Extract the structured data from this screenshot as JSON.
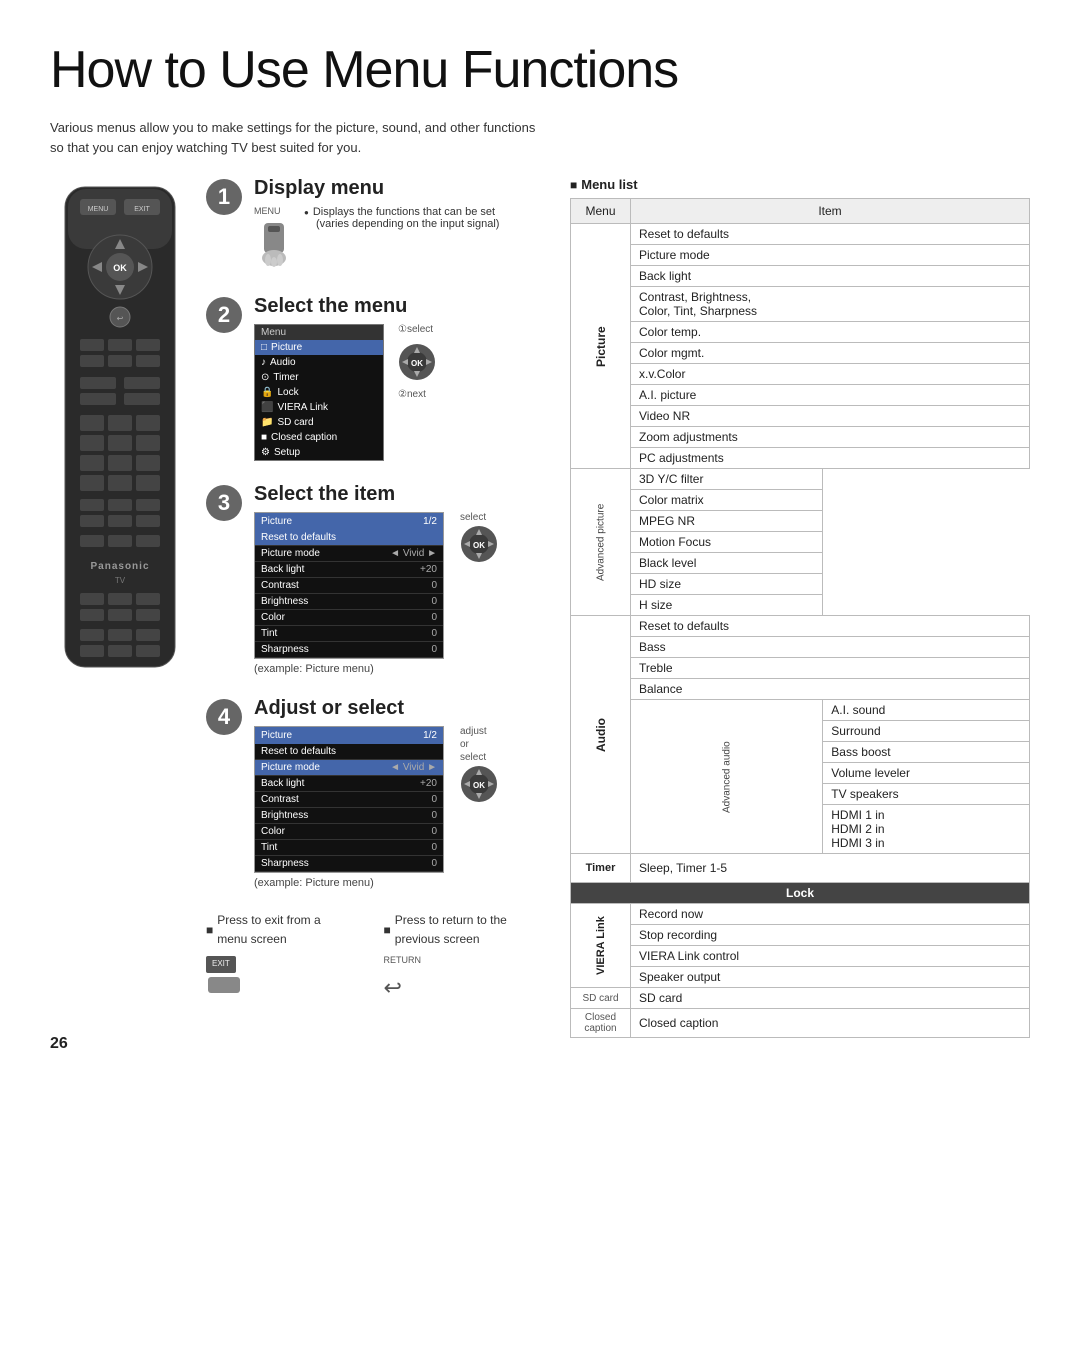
{
  "page": {
    "title": "How to Use Menu Functions",
    "intro": "Various menus allow you to make settings for the picture, sound, and other functions so that you can enjoy watching TV best suited for you.",
    "page_number": "26"
  },
  "steps": [
    {
      "number": "1",
      "title": "Display menu",
      "desc_lines": [
        "Displays the functions that can be set",
        "(varies depending on the input signal)"
      ],
      "label": "MENU"
    },
    {
      "number": "2",
      "title": "Select the menu",
      "select_label": "①select",
      "next_label": "②next",
      "menu_items": [
        "Picture",
        "Audio",
        "Timer",
        "Lock",
        "VIERA Link",
        "SD card",
        "Closed caption",
        "Setup"
      ]
    },
    {
      "number": "3",
      "title": "Select the item",
      "select_label": "select",
      "example_label": "(example: Picture menu)"
    },
    {
      "number": "4",
      "title": "Adjust or select",
      "adjust_label": "adjust",
      "or_label": "or",
      "select_label": "select",
      "example_label": "(example: Picture menu)"
    }
  ],
  "press_exit": {
    "title": "Press to exit from a menu screen",
    "button_label": "EXIT"
  },
  "press_return": {
    "title": "Press to return to the previous screen",
    "button_label": "RETURN"
  },
  "picture_menu": {
    "header_left": "Picture",
    "header_right": "1/2",
    "rows": [
      {
        "label": "Reset to defaults",
        "value": ""
      },
      {
        "label": "Picture mode",
        "value": "Vivid",
        "has_arrows": true
      },
      {
        "label": "Back light",
        "value": "+20"
      },
      {
        "label": "Contrast",
        "value": "0"
      },
      {
        "label": "Brightness",
        "value": "0"
      },
      {
        "label": "Color",
        "value": "0"
      },
      {
        "label": "Tint",
        "value": "0"
      },
      {
        "label": "Sharpness",
        "value": "0"
      }
    ]
  },
  "menu_list": {
    "header": "Menu list",
    "columns": [
      "Menu",
      "Item"
    ],
    "sections": [
      {
        "menu_label": "Picture",
        "sub_label": "",
        "items": [
          "Reset to defaults",
          "Picture mode",
          "Back light",
          "Contrast, Brightness, Color, Tint, Sharpness",
          "Color temp.",
          "Color mgmt.",
          "x.v.Color",
          "A.I. picture",
          "Video NR",
          "Zoom adjustments",
          "PC adjustments"
        ]
      },
      {
        "menu_label": "Advanced picture",
        "sub_label": "Advanced picture",
        "items": [
          "3D Y/C filter",
          "Color matrix",
          "MPEG NR",
          "Motion Focus",
          "Black level",
          "HD size",
          "H size"
        ]
      },
      {
        "menu_label": "Audio",
        "sub_label": "",
        "items": [
          "Reset to defaults",
          "Bass",
          "Treble",
          "Balance"
        ]
      },
      {
        "menu_label": "Advanced audio",
        "sub_label": "Advanced audio",
        "items": [
          "A.I. sound",
          "Surround",
          "Bass boost",
          "Volume leveler",
          "TV speakers",
          "HDMI 1 in\nHDMI 2 in\nHDMI 3 in"
        ]
      },
      {
        "menu_label": "Timer",
        "sub_label": "",
        "items": [
          "Sleep, Timer 1-5"
        ]
      },
      {
        "menu_label": "Lock",
        "sub_label": "",
        "items": []
      },
      {
        "menu_label": "VIERA Link",
        "sub_label": "",
        "items": [
          "Record now",
          "Stop recording",
          "VIERA Link control",
          "Speaker output"
        ]
      },
      {
        "menu_label": "SD card",
        "sub_label": "",
        "items": [
          "SD card"
        ]
      },
      {
        "menu_label": "Closed caption",
        "sub_label": "",
        "items": [
          "Closed caption"
        ]
      }
    ]
  }
}
